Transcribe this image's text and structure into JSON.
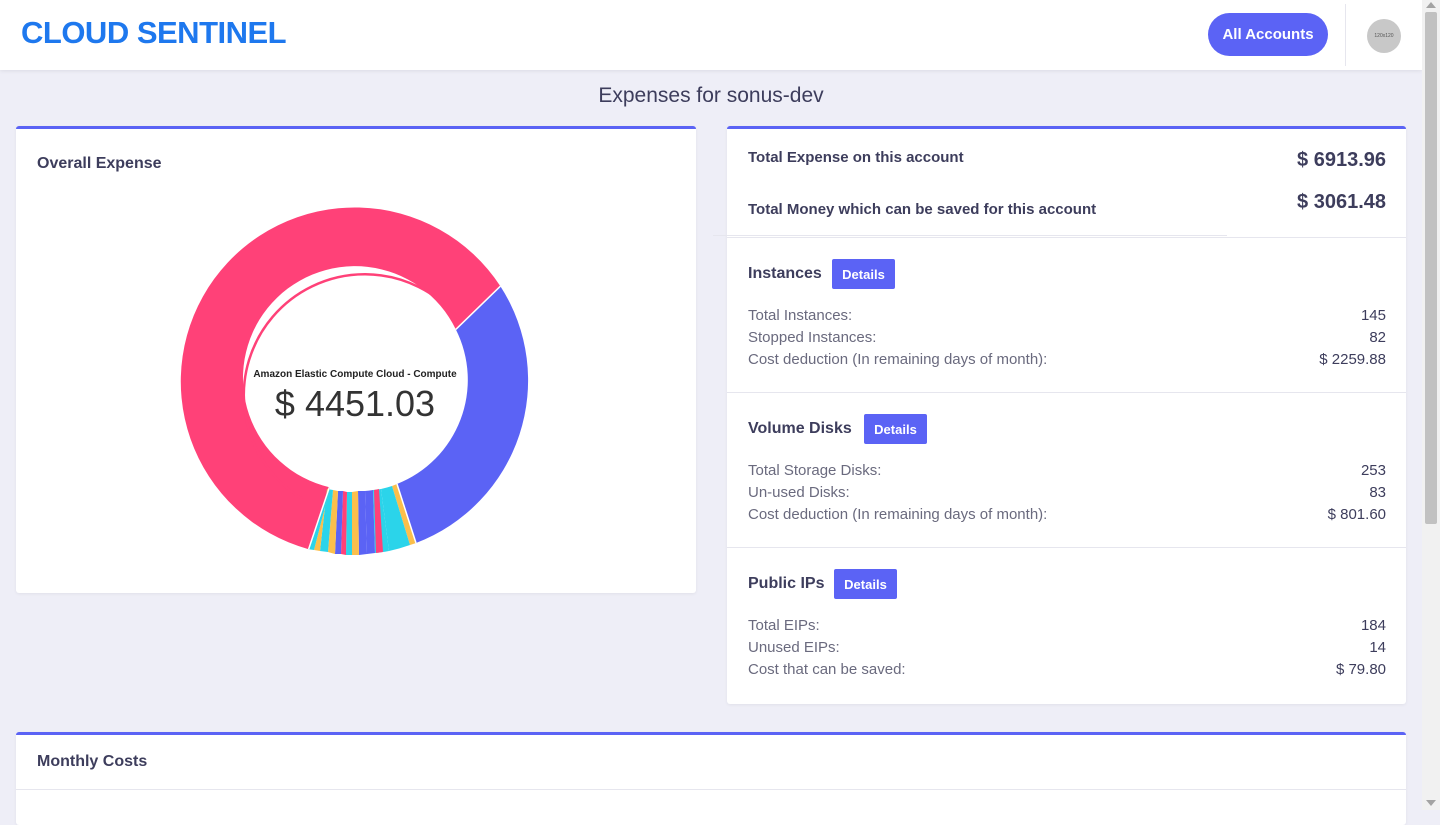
{
  "header": {
    "logo": "CLOUD SENTINEL",
    "all_accounts_label": "All Accounts",
    "avatar_text": "120x120"
  },
  "page_title": "Expenses for sonus-dev",
  "overall_expense": {
    "title": "Overall Expense",
    "center_label": "Amazon Elastic Compute Cloud - Compute",
    "center_value": "$ 4451.03",
    "colors": [
      "#ff4178",
      "#5b63f5",
      "#2bd4ea",
      "#fbbf4b"
    ]
  },
  "summary": {
    "total_expense_label": "Total Expense on this account",
    "total_expense_value": "$ 6913.96",
    "savings_label": "Total Money which can be saved for this account",
    "savings_value": "$ 3061.48"
  },
  "sections": [
    {
      "title": "Instances",
      "button": "Details",
      "rows": [
        {
          "label": "Total Instances:",
          "value": "145"
        },
        {
          "label": "Stopped Instances:",
          "value": "82"
        },
        {
          "label": "Cost deduction (In remaining days of month):",
          "value": "$ 2259.88"
        }
      ]
    },
    {
      "title": "Volume Disks",
      "button": "Details",
      "rows": [
        {
          "label": "Total Storage Disks:",
          "value": "253"
        },
        {
          "label": "Un-used Disks:",
          "value": "83"
        },
        {
          "label": "Cost deduction (In remaining days of month):",
          "value": "$ 801.60"
        }
      ]
    },
    {
      "title": "Public IPs",
      "button": "Details",
      "rows": [
        {
          "label": "Total EIPs:",
          "value": "184"
        },
        {
          "label": "Unused EIPs:",
          "value": "14"
        },
        {
          "label": "Cost that can be saved:",
          "value": "$ 79.80"
        }
      ]
    }
  ],
  "monthly_costs": {
    "title": "Monthly Costs"
  }
}
